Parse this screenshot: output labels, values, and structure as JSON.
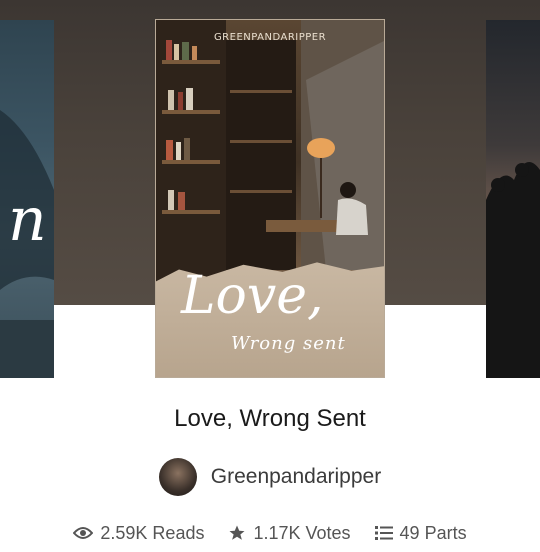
{
  "story": {
    "cover_author": "GREENPANDARIPPER",
    "cover_title_line1": "Love,",
    "cover_title_line2": "Wrong sent",
    "title": "Love, Wrong Sent",
    "author": "Greenpandaripper"
  },
  "stats": {
    "reads": "2.59K Reads",
    "votes": "1.17K Votes",
    "parts": "49 Parts"
  },
  "icons": {
    "reads": "eye-icon",
    "votes": "star-icon",
    "parts": "list-icon"
  }
}
